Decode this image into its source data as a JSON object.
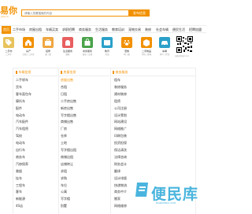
{
  "header": {
    "logo_text": "易你",
    "logo_sub": "yini.cn",
    "search_placeholder": "请输入您要搜索的内容",
    "search_button": "发布信息"
  },
  "nav": {
    "items": [
      {
        "label": "首页"
      },
      {
        "label": "二手市场"
      },
      {
        "label": "房屋出租"
      },
      {
        "label": "车辆买卖"
      },
      {
        "label": "求职招聘"
      },
      {
        "label": "商务服务"
      },
      {
        "label": "生活服务"
      },
      {
        "label": "教育培训"
      },
      {
        "label": "宠物交易"
      },
      {
        "label": "装修"
      },
      {
        "label": "社会车辆"
      },
      {
        "label": "便民生活"
      },
      {
        "label": "招聘加盟"
      }
    ]
  },
  "categories": [
    {
      "label": "二手市",
      "sub": "二手车",
      "color": "#e8c25c",
      "icon": "tag-icon"
    },
    {
      "label": "房产",
      "sub": "合租 | 二手房",
      "color": "#f29100",
      "icon": "house-icon"
    },
    {
      "label": "招聘",
      "sub": "兼 | 职",
      "color": "#f0a640",
      "icon": "briefcase-icon"
    },
    {
      "label": "生活服务",
      "sub": "搬家",
      "color": "#e85f5f",
      "icon": "hand-icon"
    },
    {
      "label": "商务服务",
      "sub": "装修 | 法律",
      "color": "#4aa34a",
      "icon": "bag-icon"
    },
    {
      "label": "教育",
      "sub": "外语",
      "color": "#2ba0c9",
      "icon": "book-icon"
    },
    {
      "label": "宠物",
      "sub": "狗 | 猫",
      "color": "#f29100",
      "icon": "paw-icon"
    },
    {
      "label": "二手物品",
      "sub": "手机 | 家电",
      "color": "#f29100",
      "icon": "box-icon"
    },
    {
      "label": "车辆",
      "sub": "中介 | 代驾",
      "color": "#2ba0c9",
      "icon": "car-icon"
    }
  ],
  "qr": {
    "caption": "扫码访问yini.cn"
  },
  "columns": [
    {
      "title": "车辆信息",
      "items": [
        "二手轿车",
        "货车",
        "客车面包车",
        "摩托车",
        "配件",
        "电动车",
        "汽车配件",
        "汽车租赁",
        "驾校",
        "电动车",
        "自行车",
        "商务车",
        "汽修保养",
        "救援",
        "挂车",
        "工程车",
        "客车",
        "新能源",
        "4S店"
      ]
    },
    {
      "title": "房屋信息",
      "items": [
        "房屋出售",
        "合租",
        "日租",
        "二手房出售",
        "新房出售",
        "写字楼出售",
        "商铺出售",
        "厂房",
        "仓库",
        "土地",
        "写字楼出租",
        "商铺出租",
        "店铺转让",
        "求租",
        "求购",
        "车位",
        "公寓",
        "写字楼",
        "别墅"
      ]
    },
    {
      "title": "商务服务",
      "items": [
        "租车",
        "装修服务",
        "建材装修",
        "租赁",
        "公司注册",
        "设计策划",
        "网站建设",
        "网络推广",
        "印刷包装",
        "投资担保",
        "保洁清洗",
        "法律咨询",
        "财务会计",
        "翻译",
        "设计排版",
        "快递物流",
        "商务中介",
        "搬家",
        "网络维修"
      ]
    }
  ],
  "watermark": {
    "text": "便民库",
    "sub": "BIANMINKU.COM"
  }
}
